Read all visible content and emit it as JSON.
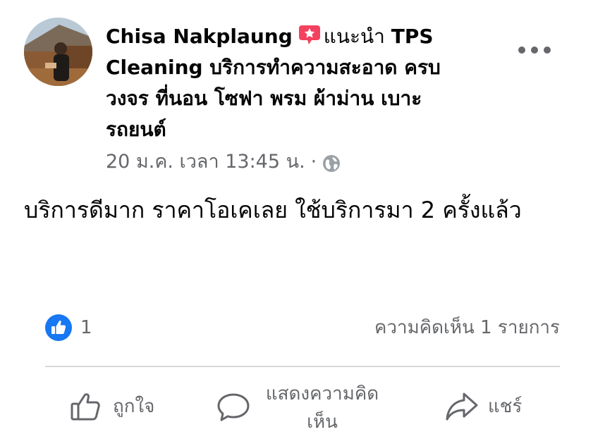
{
  "post": {
    "author": "Chisa Nakplaung",
    "recommends": "แนะนำ",
    "page_name": "TPS Cleaning บริการทำความสะอาด ครบวงจร ที่นอน โซฟา พรม ผ้าม่าน เบาะรถยนต์",
    "timestamp": "20 ม.ค. เวลา 13:45 น.",
    "separator": "·",
    "audience_icon": "globe-icon",
    "badge_icon": "recommend-star-icon",
    "more_icon": "more-options-icon",
    "text": "บริการดีมาก ราคาโอเคเลย ใช้บริการมา 2 ครั้งแล้ว"
  },
  "stats": {
    "like_count": "1",
    "comment_count_label": "ความคิดเห็น 1 รายการ"
  },
  "actions": {
    "like_label": "ถูกใจ",
    "comment_label": "แสดงความคิดเห็น",
    "share_label": "แชร์"
  },
  "colors": {
    "brand_blue": "#1877f2",
    "badge_red": "#f3425f",
    "secondary_text": "#65676b",
    "primary_text": "#050505"
  }
}
